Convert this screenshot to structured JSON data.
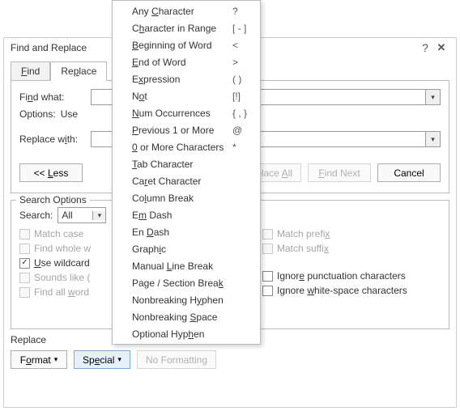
{
  "dialog": {
    "title": "Find and Replace",
    "help_tooltip": "Help",
    "close_tooltip": "Close"
  },
  "tabs": {
    "find": "Find",
    "replace": "Replace"
  },
  "labels": {
    "find_what": "Find what:",
    "options": "Options:",
    "options_value": "Use",
    "replace_with": "Replace with:"
  },
  "buttons": {
    "less": "<< Less",
    "replace_all": "Replace All",
    "find_next": "Find Next",
    "cancel": "Cancel",
    "format": "Format",
    "special": "Special",
    "no_formatting": "No Formatting"
  },
  "search_options": {
    "legend": "Search Options",
    "search_label": "Search:",
    "search_value": "All",
    "checks": {
      "match_case": "Match case",
      "whole_words": "Find whole w",
      "use_wildcards": "Use wildcard",
      "sounds_like": "Sounds like (",
      "find_all_wordforms": "Find all word",
      "match_prefix": "Match prefix",
      "match_suffix": "Match suffix",
      "ignore_punct": "Ignore punctuation characters",
      "ignore_whitespace": "Ignore white-space characters"
    }
  },
  "replace_section": {
    "label": "Replace"
  },
  "menu": [
    {
      "label_html": "Any <u>C</u>haracter",
      "shortcut": "?"
    },
    {
      "label_html": "C<u>h</u>aracter in Range",
      "shortcut": "[ - ]"
    },
    {
      "label_html": "<u>B</u>eginning of Word",
      "shortcut": "<"
    },
    {
      "label_html": "<u>E</u>nd of Word",
      "shortcut": ">"
    },
    {
      "label_html": "E<u>x</u>pression",
      "shortcut": "( )"
    },
    {
      "label_html": "N<u>o</u>t",
      "shortcut": "[!]"
    },
    {
      "label_html": "<u>N</u>um Occurrences",
      "shortcut": "{ , }"
    },
    {
      "label_html": "<u>P</u>revious 1 or More",
      "shortcut": "@"
    },
    {
      "label_html": "<u>0</u> or More Characters",
      "shortcut": "*"
    },
    {
      "label_html": "<u>T</u>ab Character",
      "shortcut": ""
    },
    {
      "label_html": "Ca<u>r</u>et Character",
      "shortcut": ""
    },
    {
      "label_html": "Co<u>l</u>umn Break",
      "shortcut": ""
    },
    {
      "label_html": "E<u>m</u> Dash",
      "shortcut": ""
    },
    {
      "label_html": "En <u>D</u>ash",
      "shortcut": ""
    },
    {
      "label_html": "Graph<u>i</u>c",
      "shortcut": ""
    },
    {
      "label_html": "Manual <u>L</u>ine Break",
      "shortcut": ""
    },
    {
      "label_html": "Page / Section Brea<u>k</u>",
      "shortcut": ""
    },
    {
      "label_html": "Nonbreaking H<u>y</u>phen",
      "shortcut": ""
    },
    {
      "label_html": "Nonbreaking <u>S</u>pace",
      "shortcut": ""
    },
    {
      "label_html": "Optional Hyp<u>h</u>en",
      "shortcut": ""
    }
  ]
}
